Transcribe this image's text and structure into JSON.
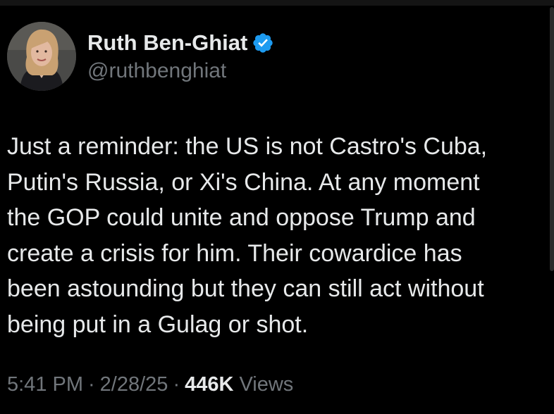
{
  "author": {
    "display_name": "Ruth Ben-Ghiat",
    "handle": "@ruthbenghiat",
    "verified_icon": "verified-badge-icon",
    "verified_color": "#1d9bf0"
  },
  "tweet": {
    "text": "Just a reminder: the US is not Castro's Cuba,\nPutin's Russia, or Xi's China. At any moment\nthe GOP could unite and oppose Trump and\ncreate a crisis for him. Their cowardice has\nbeen astounding but they can still act without\nbeing put in a Gulag or shot."
  },
  "meta": {
    "time": "5:41 PM",
    "separator": "·",
    "date": "2/28/25",
    "views_count": "446K",
    "views_label": "Views"
  },
  "colors": {
    "background": "#000000",
    "primary_text": "#e7e9ea",
    "secondary_text": "#71767b"
  }
}
